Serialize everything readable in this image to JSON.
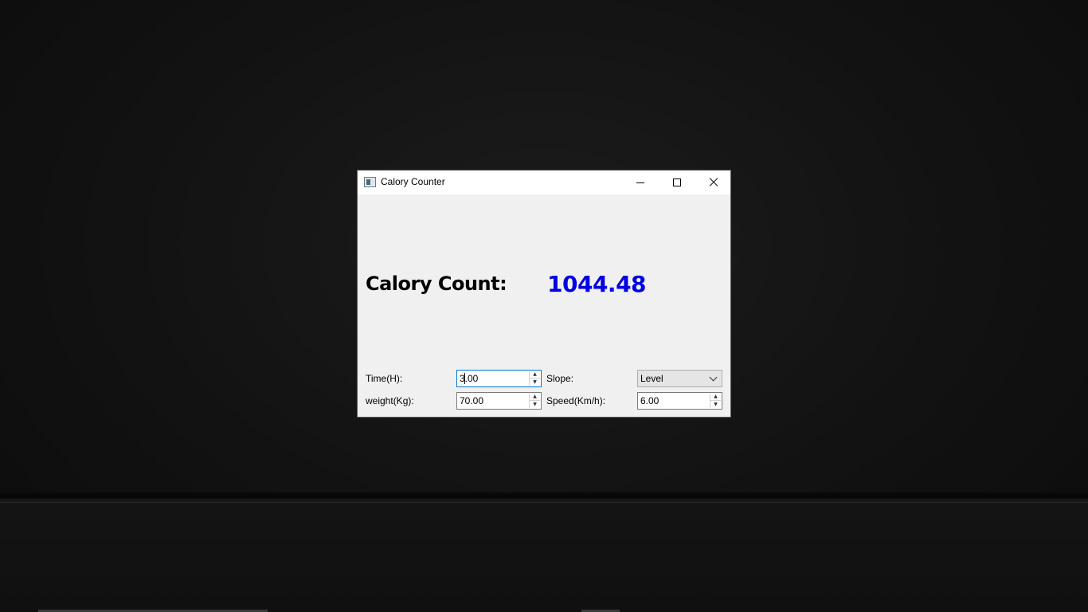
{
  "window": {
    "title": "Calory Counter",
    "icon": "app-window-icon"
  },
  "result": {
    "label": "Calory Count:",
    "value": "1044.48",
    "value_color": "#0000e0"
  },
  "fields": {
    "time": {
      "label": "Time(H):",
      "value": "3.00"
    },
    "weight": {
      "label": "weight(Kg):",
      "value": "70.00"
    },
    "slope": {
      "label": "Slope:",
      "selected": "Level"
    },
    "speed": {
      "label": "Speed(Km/h):",
      "value": "6.00"
    }
  },
  "icons": {
    "spin_up": "▲",
    "spin_down": "▼"
  }
}
